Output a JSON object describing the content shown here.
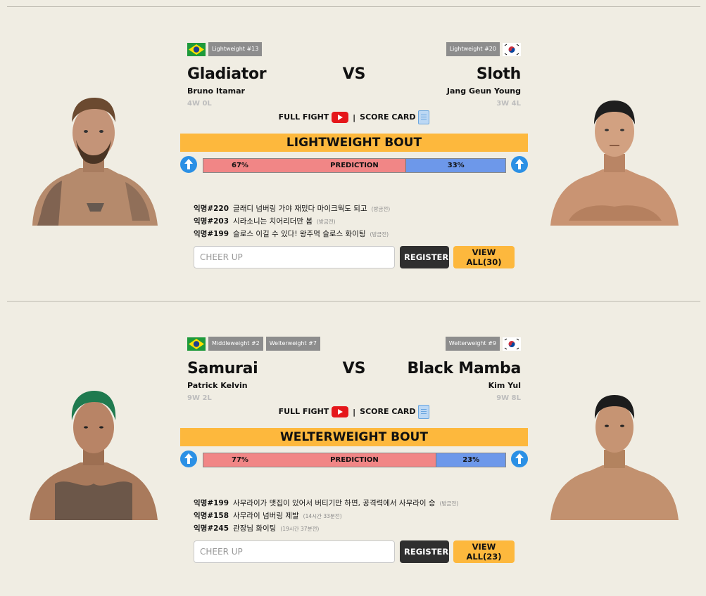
{
  "bouts": [
    {
      "left": {
        "ranks": [
          "Lightweight #13"
        ],
        "nickname": "Gladiator",
        "name": "Bruno Itamar",
        "record": "4W 0L",
        "flag": "brazil-flag"
      },
      "right": {
        "ranks": [
          "Lightweight #20"
        ],
        "nickname": "Sloth",
        "name": "Jang Geun Young",
        "record": "3W 4L",
        "flag": "south-korea-flag"
      },
      "vs": "VS",
      "full_fight": "FULL FIGHT",
      "separator": "|",
      "score_card": "SCORE CARD",
      "bout_title": "LIGHTWEIGHT BOUT",
      "prediction": {
        "label": "PREDICTION",
        "left_pct": "67%",
        "right_pct": "33%",
        "left_value": 67,
        "right_value": 33
      },
      "comments": [
        {
          "user": "익명#220",
          "text": "글래디 넘버링 가야 재밌다 마이크웍도 되고",
          "time": "방금전"
        },
        {
          "user": "익명#203",
          "text": "시라소니는 치어리더만 봄",
          "time": "방금전"
        },
        {
          "user": "익명#199",
          "text": "슬로스 이길 수 있다! 왕주먹 슬로스 화이팅",
          "time": "방금전"
        }
      ],
      "input_placeholder": "CHEER UP",
      "register_label": "REGISTER",
      "view_all_label": "VIEW ALL(30)"
    },
    {
      "left": {
        "ranks": [
          "Middleweight #2",
          "Welterweight #7"
        ],
        "nickname": "Samurai",
        "name": "Patrick Kelvin",
        "record": "9W 2L",
        "flag": "brazil-flag"
      },
      "right": {
        "ranks": [
          "Welterweight #9"
        ],
        "nickname": "Black Mamba",
        "name": "Kim Yul",
        "record": "9W 8L",
        "flag": "south-korea-flag"
      },
      "vs": "VS",
      "full_fight": "FULL FIGHT",
      "separator": "|",
      "score_card": "SCORE CARD",
      "bout_title": "WELTERWEIGHT BOUT",
      "prediction": {
        "label": "PREDICTION",
        "left_pct": "77%",
        "right_pct": "23%",
        "left_value": 77,
        "right_value": 23
      },
      "comments": [
        {
          "user": "익명#199",
          "text": "사무라이가 맷집이 있어서 버티기만 하면, 공격력에서 사무라이 승",
          "time": "방금전"
        },
        {
          "user": "익명#158",
          "text": "사무라이 넘버링 제발",
          "time": "14시간 33분전"
        },
        {
          "user": "익명#245",
          "text": "관장님 화이팅",
          "time": "19시간 37분전"
        }
      ],
      "input_placeholder": "CHEER UP",
      "register_label": "REGISTER",
      "view_all_label": "VIEW ALL(23)"
    }
  ],
  "colors": {
    "background": "#f0ede3",
    "accent_yellow": "#fdb83d",
    "pred_red": "#f18686",
    "pred_blue": "#6d98ea",
    "arrow_blue": "#2b90e5",
    "tag_gray": "#8d8d8d"
  }
}
